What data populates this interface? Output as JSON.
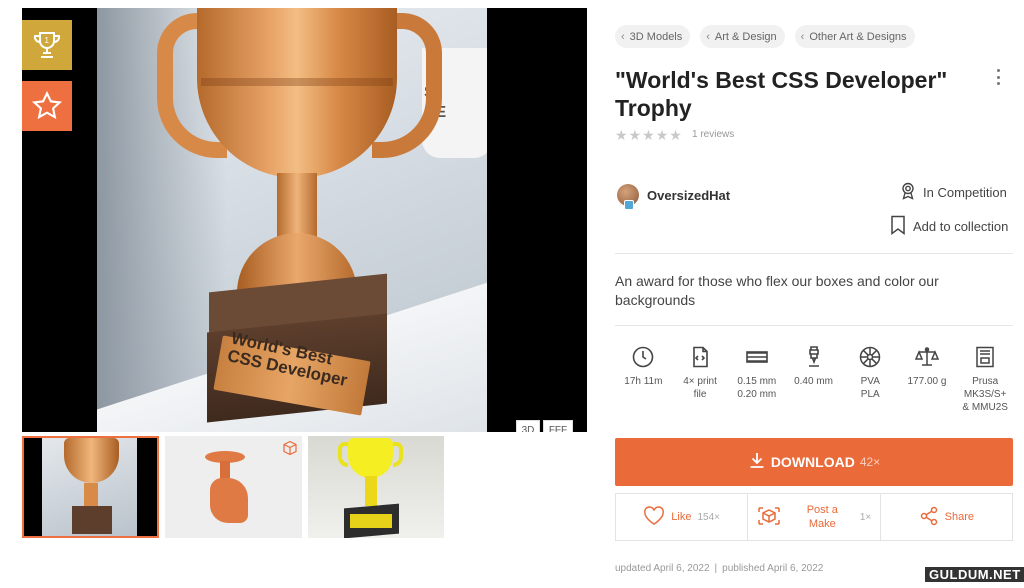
{
  "gallery": {
    "view_3d": "3D",
    "view_fff": "FFF",
    "mug_text": "S\nNE",
    "plaque_text": "World's Best\nCSS Developer"
  },
  "breadcrumbs": [
    "3D Models",
    "Art & Design",
    "Other Art & Designs"
  ],
  "title": "\"World's Best CSS Developer\" Trophy",
  "rating": {
    "stars_filled": 0,
    "stars_total": 5,
    "reviews": "1 reviews"
  },
  "author": {
    "name": "OversizedHat"
  },
  "actions_side": {
    "competition": "In Competition",
    "collection": "Add to collection"
  },
  "description": "An award for those who flex our boxes and color our backgrounds",
  "specs": [
    {
      "icon": "clock-icon",
      "text": "17h 11m"
    },
    {
      "icon": "print-file-icon",
      "text": "4× print\nfile"
    },
    {
      "icon": "layer-height-icon",
      "text": "0.15 mm\n0.20 mm"
    },
    {
      "icon": "nozzle-icon",
      "text": "0.40 mm"
    },
    {
      "icon": "filament-spool-icon",
      "text": "PVA\nPLA"
    },
    {
      "icon": "scale-icon",
      "text": "177.00 g"
    },
    {
      "icon": "printer-icon",
      "text": "Prusa\nMK3S/S+\n& MMU2S"
    }
  ],
  "download": {
    "label": "DOWNLOAD",
    "count": "42×"
  },
  "social": {
    "like_label": "Like",
    "like_count": "154×",
    "make_label": "Post a\nMake",
    "make_count": "1×",
    "share_label": "Share"
  },
  "dates": {
    "updated": "updated April 6, 2022",
    "separator": "|",
    "published": "published April 6, 2022"
  },
  "watermark": "GULDUM.NET",
  "colors": {
    "accent": "#ea6a39",
    "gold_badge": "#cfa73a",
    "trophy": "#d88a47"
  }
}
